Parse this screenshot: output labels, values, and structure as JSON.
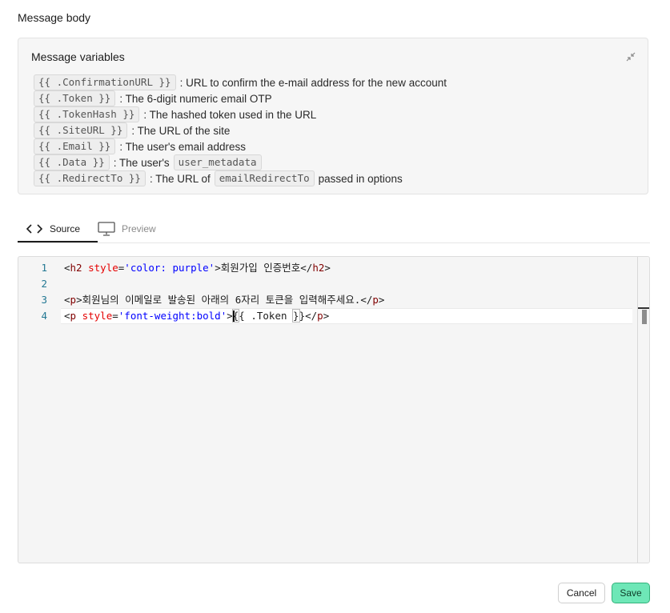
{
  "section_title": "Message body",
  "variables_panel": {
    "title": "Message variables",
    "collapse_icon": "collapse-arrows-icon",
    "rows": [
      {
        "chip": "{{ .ConfirmationURL }}",
        "text": ": URL to confirm the e-mail address for the new account"
      },
      {
        "chip": "{{ .Token }}",
        "text": ": The 6-digit numeric email OTP"
      },
      {
        "chip": "{{ .TokenHash }}",
        "text": ": The hashed token used in the URL"
      },
      {
        "chip": "{{ .SiteURL }}",
        "text": ": The URL of the site"
      },
      {
        "chip": "{{ .Email }}",
        "text": ": The user's email address"
      },
      {
        "chip": "{{ .Data }}",
        "text": ": The user's",
        "chip2": "user_metadata"
      },
      {
        "chip": "{{ .RedirectTo }}",
        "text": ": The URL of",
        "chip2": "emailRedirectTo",
        "text2": "passed in options"
      }
    ]
  },
  "tabs": [
    {
      "label": "Source",
      "icon": "code-brackets-icon",
      "active": true
    },
    {
      "label": "Preview",
      "icon": "monitor-icon",
      "active": false
    }
  ],
  "editor": {
    "line_numbers": [
      "1",
      "2",
      "3",
      "4"
    ],
    "lines": [
      "<h2 style='color: purple'>회원가입 인증번호</h2>",
      "",
      "<p>회원님의 이메일로 발송된 아래의 6자리 토큰을 입력해주세요.</p>",
      "<p style='font-weight:bold'>{{ .Token }}</p>"
    ],
    "active_line": 4
  },
  "buttons": {
    "cancel": "Cancel",
    "save": "Save"
  },
  "colors": {
    "save_bg": "#6ee7b7",
    "tag": "#800000",
    "attr": "#e50000",
    "string": "#0000ff",
    "line_number": "#237893"
  }
}
